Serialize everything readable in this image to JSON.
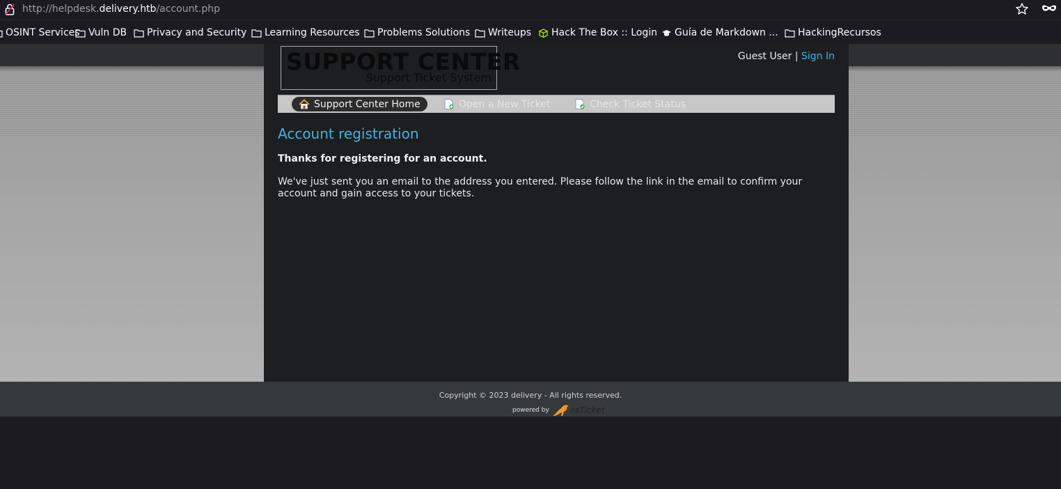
{
  "browser": {
    "url_prefix": "http://helpdesk.",
    "url_host": "delivery.htb",
    "url_path": "/account.php"
  },
  "bookmarks": [
    {
      "label": "OSINT Services",
      "icon": "folder-icon"
    },
    {
      "label": "Vuln DB",
      "icon": "folder-icon"
    },
    {
      "label": "Privacy and Security",
      "icon": "folder-icon"
    },
    {
      "label": "Learning Resources",
      "icon": "folder-icon"
    },
    {
      "label": "Problems Solutions",
      "icon": "folder-icon"
    },
    {
      "label": "Writeups",
      "icon": "folder-icon"
    },
    {
      "label": "Hack The Box :: Login",
      "icon": "htb-cube-icon"
    },
    {
      "label": "Guía de Markdown ...",
      "icon": "graduation-cap-icon"
    },
    {
      "label": "HackingRecursos",
      "icon": "folder-icon"
    }
  ],
  "header": {
    "logo_title": "SUPPORT CENTER",
    "logo_subtitle": "Support Ticket System",
    "guest_label": "Guest User",
    "separator": "|",
    "sign_in": "Sign In"
  },
  "nav": {
    "home": "Support Center Home",
    "open_ticket": "Open a New Ticket",
    "check_status": "Check Ticket Status"
  },
  "content": {
    "title": "Account registration",
    "thanks": "Thanks for registering for an account.",
    "message": "We've just sent you an email to the address you entered. Please follow the link in the email to confirm your account and gain access to your tickets."
  },
  "footer": {
    "copyright": "Copyright © 2023 delivery - All rights reserved.",
    "powered_by": "powered by",
    "brand": "osTicket"
  },
  "colors": {
    "link": "#3fb4e6",
    "page_bg": "#1d1e20",
    "footer_bg": "#343a3c"
  }
}
